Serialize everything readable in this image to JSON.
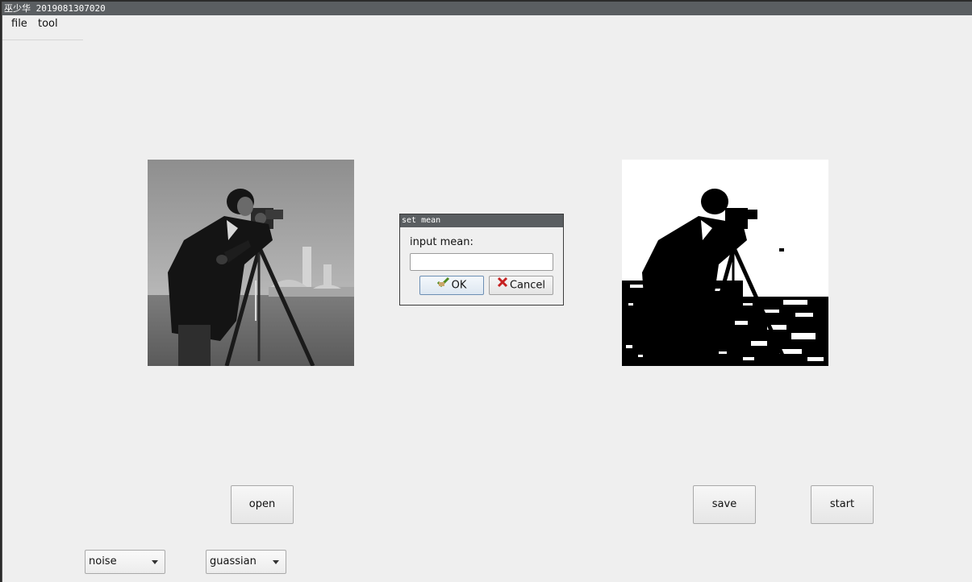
{
  "window": {
    "title": "巫少华 2019081307020"
  },
  "menu": [
    {
      "label": "file"
    },
    {
      "label": "tool"
    }
  ],
  "buttons": {
    "open": "open",
    "save": "save",
    "start": "start"
  },
  "combos": {
    "noise": "noise",
    "type": "guassian"
  },
  "dialog": {
    "title": "set mean",
    "label": "input mean:",
    "input_value": "",
    "ok": "OK",
    "cancel": "Cancel"
  },
  "images": {
    "original": "cameraman grayscale",
    "result": "cameraman binarized"
  }
}
